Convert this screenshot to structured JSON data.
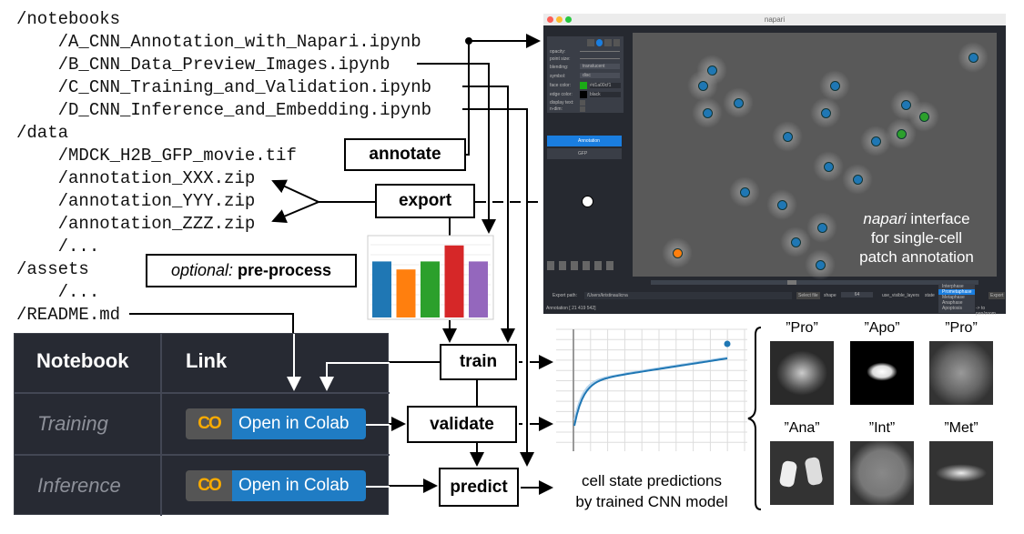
{
  "file_tree": [
    "/notebooks",
    "    /A_CNN_Annotation_with_Napari.ipynb",
    "    /B_CNN_Data_Preview_Images.ipynb",
    "    /C_CNN_Training_and_Validation.ipynb",
    "    /D_CNN_Inference_and_Embedding.ipynb",
    "/data",
    "    /MDCK_H2B_GFP_movie.tif",
    "    /annotation_XXX.zip",
    "    /annotation_YYY.zip",
    "    /annotation_ZZZ.zip",
    "    /...",
    "/assets",
    "    /...",
    "/README.md"
  ],
  "steps": {
    "annotate": "annotate",
    "export": "export",
    "preprocess_prefix": "optional:",
    "preprocess": "pre-process",
    "train": "train",
    "validate": "validate",
    "predict": "predict"
  },
  "table": {
    "headers": [
      "Notebook",
      "Link"
    ],
    "rows": [
      {
        "name": "Training",
        "button": "Open in Colab",
        "logo": "CO"
      },
      {
        "name": "Inference",
        "button": "Open in Colab",
        "logo": "CO"
      }
    ]
  },
  "napari": {
    "title": "napari",
    "layer_controls": {
      "opacity": "opacity:",
      "point_size": "point size:",
      "blending": "blending:",
      "blending_value": "translucent",
      "symbol": "symbol:",
      "symbol_value": "disc",
      "face_color": "face color:",
      "face_color_value": "#d1a00cf1",
      "edge_color": "edge color:",
      "edge_color_value": "black",
      "display_text": "display text:",
      "n_dim": "n-dim:"
    },
    "layers": [
      "Annotation",
      "GFP"
    ],
    "export_path_label": "Export path:",
    "export_path": "/Users/kristinaulicna",
    "select_file": "Select file",
    "shape_label": "shape",
    "shape_value": "64",
    "use_visible_layers": "use_visible_layers",
    "state_label": "state",
    "state_options": [
      "Interphase",
      "Prometaphase",
      "Metaphase",
      "Anaphase",
      "Apoptosis"
    ],
    "state_selected": "Prometaphase",
    "export_button": "Export",
    "status": "Annotation [ 21 419 542]",
    "hint": "-> to pan/zoom",
    "caption_italic": "napari",
    "caption": " interface",
    "caption2": "for single-cell",
    "caption3": "patch annotation",
    "point_colors": {
      "interphase": "#1f77b4",
      "mitosis": "#2ca02c",
      "apoptosis": "#ff7f0e"
    }
  },
  "bar_colors": [
    "#1f77b4",
    "#ff7f0e",
    "#2ca02c",
    "#d62728",
    "#9467bd"
  ],
  "predictions": {
    "line1": "cell state predictions",
    "line2": "by trained CNN model",
    "labels": [
      "”Pro”",
      "”Apo”",
      "”Pro”",
      "”Ana”",
      "”Int”",
      "”Met”"
    ]
  }
}
